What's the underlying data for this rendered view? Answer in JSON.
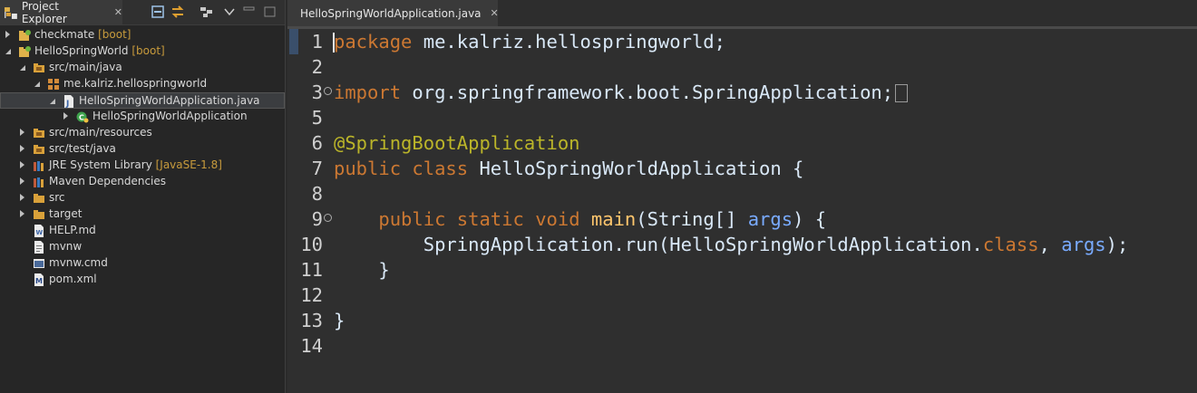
{
  "explorer": {
    "title": "Project Explorer",
    "close": "✕",
    "tree": [
      {
        "label": "checkmate",
        "decor": "[boot]",
        "icon": "boot-project-icon",
        "twisty": "closed",
        "level": 0
      },
      {
        "label": "HelloSpringWorld",
        "decor": "[boot]",
        "icon": "boot-project-icon",
        "twisty": "open",
        "level": 0
      },
      {
        "label": "src/main/java",
        "decor": "",
        "icon": "source-folder-icon",
        "twisty": "open",
        "level": 1
      },
      {
        "label": "me.kalriz.hellospringworld",
        "decor": "",
        "icon": "package-icon",
        "twisty": "open",
        "level": 2
      },
      {
        "label": "HelloSpringWorldApplication.java",
        "decor": "",
        "icon": "java-file-icon",
        "twisty": "open",
        "level": 3,
        "selected": true
      },
      {
        "label": "HelloSpringWorldApplication",
        "decor": "",
        "icon": "class-icon",
        "twisty": "closed",
        "level": 4
      },
      {
        "label": "src/main/resources",
        "decor": "",
        "icon": "source-folder-icon",
        "twisty": "closed",
        "level": 1
      },
      {
        "label": "src/test/java",
        "decor": "",
        "icon": "source-folder-icon",
        "twisty": "closed",
        "level": 1
      },
      {
        "label": "JRE System Library",
        "decor": "[JavaSE-1.8]",
        "icon": "library-icon",
        "twisty": "closed",
        "level": 1
      },
      {
        "label": "Maven Dependencies",
        "decor": "",
        "icon": "library-icon",
        "twisty": "closed",
        "level": 1
      },
      {
        "label": "src",
        "decor": "",
        "icon": "folder-icon",
        "twisty": "closed",
        "level": 1
      },
      {
        "label": "target",
        "decor": "",
        "icon": "folder-icon",
        "twisty": "closed",
        "level": 1
      },
      {
        "label": "HELP.md",
        "decor": "",
        "icon": "markdown-file-icon",
        "twisty": "none",
        "level": 1
      },
      {
        "label": "mvnw",
        "decor": "",
        "icon": "text-file-icon",
        "twisty": "none",
        "level": 1
      },
      {
        "label": "mvnw.cmd",
        "decor": "",
        "icon": "cmd-file-icon",
        "twisty": "none",
        "level": 1
      },
      {
        "label": "pom.xml",
        "decor": "",
        "icon": "maven-file-icon",
        "twisty": "none",
        "level": 1
      }
    ]
  },
  "editor": {
    "tab_title": "HelloSpringWorldApplication.java",
    "close": "✕",
    "lines": [
      {
        "num": "1",
        "fold": false,
        "tokens": [
          {
            "t": "package",
            "c": "kw"
          },
          {
            "t": " me.kalriz.hellospringworld;",
            "c": "plain"
          }
        ]
      },
      {
        "num": "2",
        "fold": false,
        "tokens": []
      },
      {
        "num": "3",
        "fold": true,
        "tokens": [
          {
            "t": "import",
            "c": "kw"
          },
          {
            "t": " org.springframework.boot.SpringApplication;",
            "c": "plain"
          }
        ],
        "collapsed": true
      },
      {
        "num": "5",
        "fold": false,
        "tokens": []
      },
      {
        "num": "6",
        "fold": false,
        "tokens": [
          {
            "t": "@SpringBootApplication",
            "c": "ann"
          }
        ]
      },
      {
        "num": "7",
        "fold": false,
        "tokens": [
          {
            "t": "public",
            "c": "kw"
          },
          {
            "t": " ",
            "c": "plain"
          },
          {
            "t": "class",
            "c": "kw"
          },
          {
            "t": " HelloSpringWorldApplication {",
            "c": "plain"
          }
        ]
      },
      {
        "num": "8",
        "fold": false,
        "tokens": []
      },
      {
        "num": "9",
        "fold": true,
        "tokens": [
          {
            "t": "    ",
            "c": "plain"
          },
          {
            "t": "public",
            "c": "kw"
          },
          {
            "t": " ",
            "c": "plain"
          },
          {
            "t": "static",
            "c": "kw"
          },
          {
            "t": " ",
            "c": "plain"
          },
          {
            "t": "void",
            "c": "kw"
          },
          {
            "t": " ",
            "c": "plain"
          },
          {
            "t": "main",
            "c": "meth"
          },
          {
            "t": "(String[] ",
            "c": "plain"
          },
          {
            "t": "args",
            "c": "arg"
          },
          {
            "t": ") {",
            "c": "plain"
          }
        ]
      },
      {
        "num": "10",
        "fold": false,
        "tokens": [
          {
            "t": "        SpringApplication.",
            "c": "plain"
          },
          {
            "t": "run",
            "c": "plain"
          },
          {
            "t": "(HelloSpringWorldApplication.",
            "c": "plain"
          },
          {
            "t": "class",
            "c": "kw"
          },
          {
            "t": ", ",
            "c": "plain"
          },
          {
            "t": "args",
            "c": "arg"
          },
          {
            "t": ");",
            "c": "plain"
          }
        ]
      },
      {
        "num": "11",
        "fold": false,
        "tokens": [
          {
            "t": "    }",
            "c": "plain"
          }
        ]
      },
      {
        "num": "12",
        "fold": false,
        "tokens": []
      },
      {
        "num": "13",
        "fold": false,
        "tokens": [
          {
            "t": "}",
            "c": "plain"
          }
        ]
      },
      {
        "num": "14",
        "fold": false,
        "tokens": []
      }
    ]
  }
}
